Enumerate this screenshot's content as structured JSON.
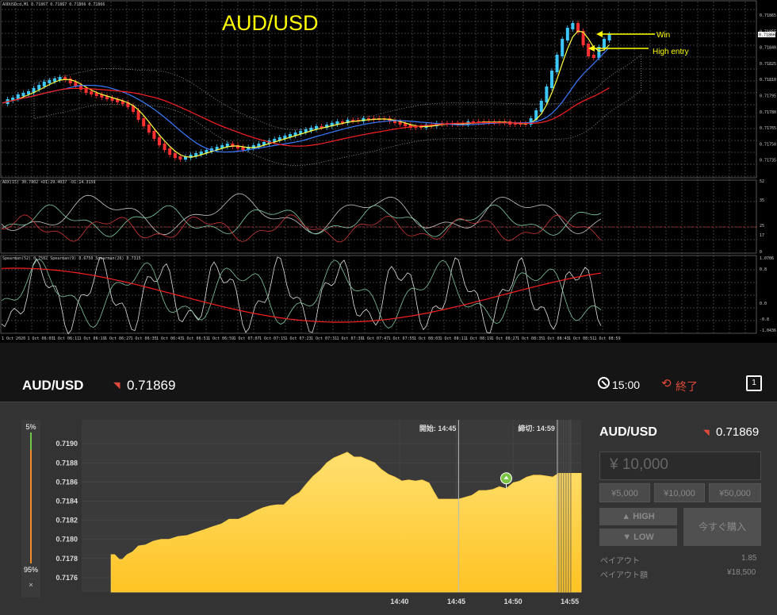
{
  "mt4": {
    "title": "AUD/USD",
    "symbol_info": "AUDUSDcd,M1  0.71867 0.71867 0.71866 0.71866",
    "price_labels": [
      "0.71865",
      "0.71855",
      "0.71840",
      "0.71825",
      "0.71810",
      "0.71795",
      "0.71780",
      "0.71765",
      "0.71750",
      "0.71735"
    ],
    "current_price_tag": "0.71866",
    "adx_header": "ADX(15) 30.7402  +DI:29.4037  -DI:14.3159",
    "adx_scale": [
      "52",
      "35",
      "25",
      "17",
      "0"
    ],
    "spearman_header": "Spearman(52) 0.7582  Spearman(9) 0.6750  Spearman(26) 0.7315",
    "spearman_scale": [
      "1.0706",
      "0.8",
      "0.0",
      "-0.8",
      "-1.0436"
    ],
    "time_labels": [
      "1 Oct 2020",
      "1 Oct 06:03",
      "1 Oct 06:11",
      "1 Oct 06:19",
      "1 Oct 06:27",
      "1 Oct 06:35",
      "1 Oct 06:43",
      "1 Oct 06:51",
      "1 Oct 06:59",
      "1 Oct 07:07",
      "1 Oct 07:15",
      "1 Oct 07:23",
      "1 Oct 07:31",
      "1 Oct 07:39",
      "1 Oct 07:47",
      "1 Oct 07:55",
      "1 Oct 08:03",
      "1 Oct 08:11",
      "1 Oct 08:19",
      "1 Oct 08:27",
      "1 Oct 08:35",
      "1 Oct 08:43",
      "1 Oct 08:51",
      "1 Oct 08:59"
    ],
    "annotation_win": "Win",
    "annotation_entry": "High entry"
  },
  "topbar": {
    "pair": "AUD/USD",
    "price": "0.71869",
    "time": "15:00",
    "status": "終了"
  },
  "gauge": {
    "top_pct": "5%",
    "bottom_pct": "95%",
    "close": "×"
  },
  "chart_data": {
    "type": "area",
    "ylim": [
      0.71745,
      0.71925
    ],
    "y_ticks": [
      "0.7190",
      "0.7188",
      "0.7186",
      "0.7184",
      "0.7182",
      "0.7180",
      "0.7178",
      "0.7176"
    ],
    "x_ticks": [
      "14:40",
      "14:45",
      "14:50",
      "14:55"
    ],
    "start_label": "開始: 14:45",
    "end_label": "締切: 14:59",
    "series": [
      {
        "values": [
          [
            14.6,
            0.71784
          ],
          [
            14.9,
            0.71784
          ],
          [
            15.3,
            0.71779
          ],
          [
            15.6,
            0.71779
          ],
          [
            16.0,
            0.71784
          ],
          [
            16.5,
            0.71787
          ],
          [
            17.0,
            0.71793
          ],
          [
            17.6,
            0.71794
          ],
          [
            18.3,
            0.71798
          ],
          [
            19.0,
            0.718
          ],
          [
            19.7,
            0.718
          ],
          [
            20.5,
            0.71803
          ],
          [
            21.3,
            0.71804
          ],
          [
            22.0,
            0.71807
          ],
          [
            22.8,
            0.7181
          ],
          [
            23.5,
            0.71813
          ],
          [
            24.3,
            0.71816
          ],
          [
            25.0,
            0.71821
          ],
          [
            25.8,
            0.71821
          ],
          [
            26.6,
            0.71825
          ],
          [
            27.4,
            0.7183
          ],
          [
            28.0,
            0.71833
          ],
          [
            28.6,
            0.71835
          ],
          [
            29.2,
            0.71836
          ],
          [
            29.8,
            0.71836
          ],
          [
            30.5,
            0.71844
          ],
          [
            31.2,
            0.71849
          ],
          [
            31.8,
            0.71858
          ],
          [
            32.4,
            0.71866
          ],
          [
            33.0,
            0.71872
          ],
          [
            33.6,
            0.7188
          ],
          [
            34.2,
            0.71885
          ],
          [
            34.8,
            0.71888
          ],
          [
            35.4,
            0.71891
          ],
          [
            36.0,
            0.71886
          ],
          [
            36.6,
            0.71886
          ],
          [
            37.2,
            0.71883
          ],
          [
            37.8,
            0.7188
          ],
          [
            38.4,
            0.71873
          ],
          [
            39.0,
            0.71868
          ],
          [
            39.6,
            0.71865
          ],
          [
            40.2,
            0.71861
          ],
          [
            40.8,
            0.71862
          ],
          [
            41.4,
            0.71861
          ],
          [
            42.0,
            0.71862
          ],
          [
            42.6,
            0.71859
          ],
          [
            43.0,
            0.7185
          ],
          [
            43.4,
            0.71842
          ],
          [
            44.0,
            0.71842
          ],
          [
            44.6,
            0.71842
          ],
          [
            45.2,
            0.71842
          ],
          [
            45.8,
            0.71844
          ],
          [
            46.4,
            0.71846
          ],
          [
            47.0,
            0.71851
          ],
          [
            47.6,
            0.71851
          ],
          [
            48.2,
            0.71852
          ],
          [
            48.8,
            0.71855
          ],
          [
            49.4,
            0.71853
          ],
          [
            50.0,
            0.71859
          ],
          [
            50.6,
            0.71861
          ],
          [
            51.2,
            0.71865
          ],
          [
            51.8,
            0.71867
          ],
          [
            52.4,
            0.71867
          ],
          [
            53.0,
            0.71866
          ],
          [
            53.5,
            0.71865
          ],
          [
            54.0,
            0.71869
          ]
        ]
      }
    ],
    "marker": {
      "x": 49.4,
      "y": 0.71853,
      "label": "entry-pin"
    }
  },
  "trade": {
    "pair": "AUD/USD",
    "price": "0.71869",
    "amount": "¥ 10,000",
    "quick": [
      "¥5,000",
      "¥10,000",
      "¥50,000"
    ],
    "high_label": "HIGH",
    "low_label": "LOW",
    "buy_label": "今すぐ購入",
    "payout_label": "ペイアウト",
    "payout_value": "1.85",
    "payout_amount_label": "ペイアウト額",
    "payout_amount_value": "¥18,500"
  },
  "colors": {
    "area_fill": "#ffc324",
    "area_top": "#ffe070",
    "ma_yellow": "#ffff40",
    "ma_blue": "#3a7cff",
    "ma_red": "#ff2020",
    "bull_candle": "#3cc8ff",
    "bear_candle": "#ff3030",
    "accent_red": "#e04a3a"
  }
}
